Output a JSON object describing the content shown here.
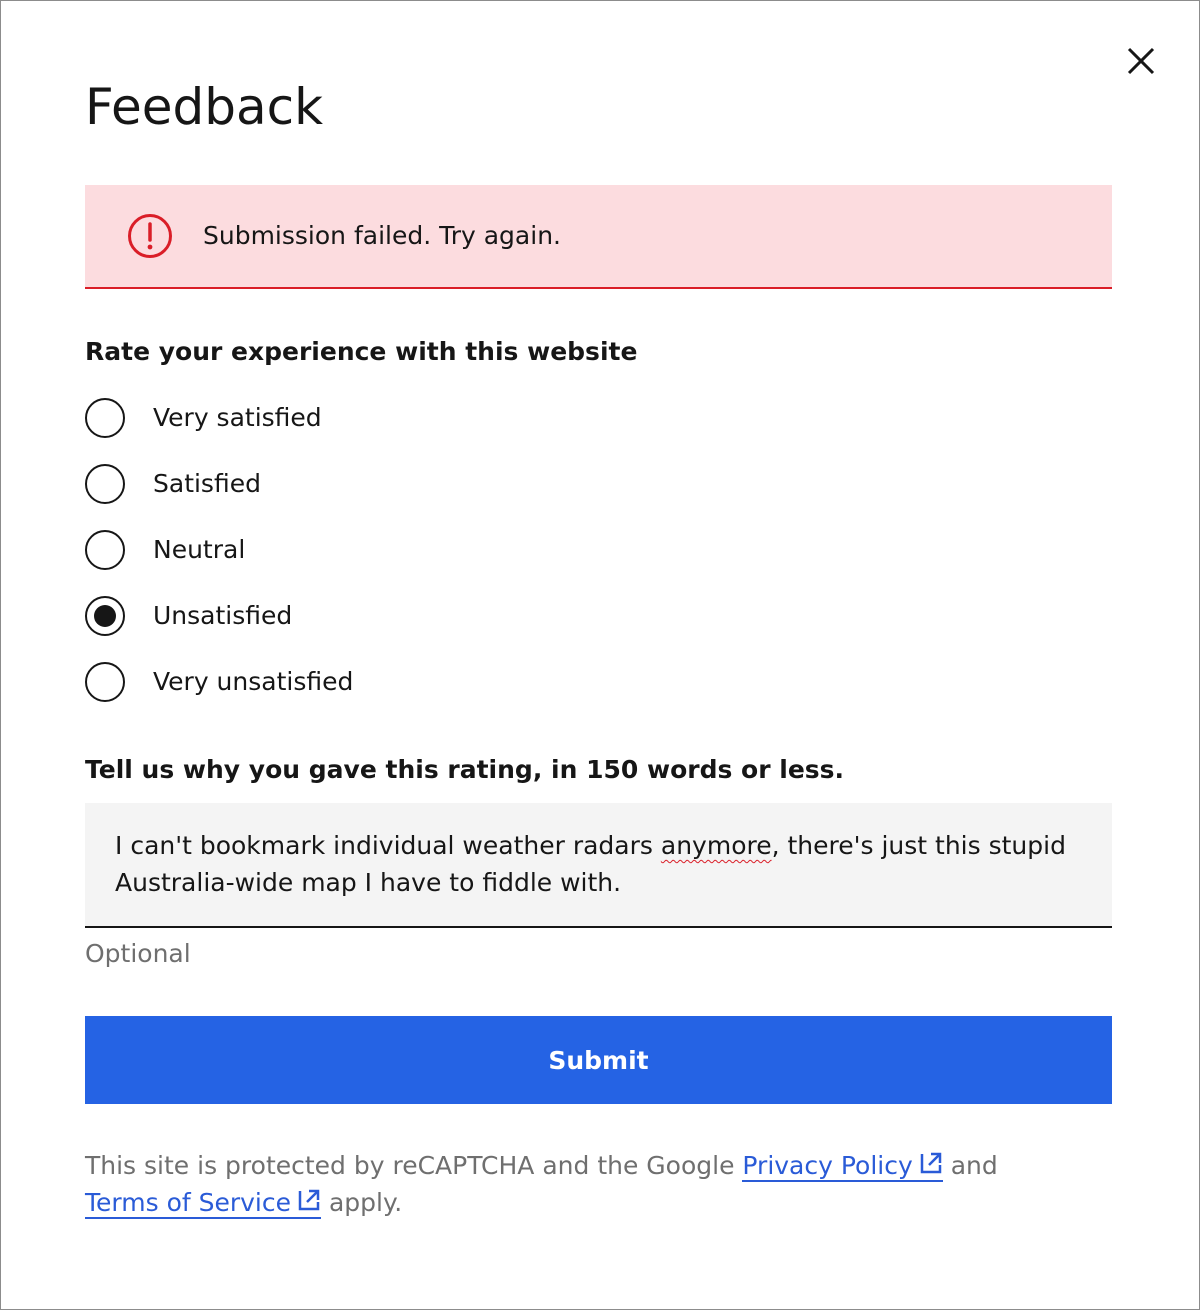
{
  "dialog": {
    "title": "Feedback",
    "close_icon": "close-icon"
  },
  "alert": {
    "icon": "error-exclamation-icon",
    "message": "Submission failed. Try again.",
    "color": "#da1e28",
    "background": "#fcdcdf"
  },
  "rating": {
    "legend": "Rate your experience with this website",
    "options": [
      {
        "label": "Very satisfied",
        "selected": false
      },
      {
        "label": "Satisfied",
        "selected": false
      },
      {
        "label": "Neutral",
        "selected": false
      },
      {
        "label": "Unsatisfied",
        "selected": true
      },
      {
        "label": "Very unsatisfied",
        "selected": false
      }
    ]
  },
  "comment": {
    "label": "Tell us why you gave this rating, in 150 words or less.",
    "value_before": "I can't bookmark individual weather radars ",
    "value_misspelled": "anymore",
    "value_after": ", there's just this stupid Australia-wide map I have to fiddle with.",
    "helper": "Optional"
  },
  "submit": {
    "label": "Submit",
    "color": "#2563e4"
  },
  "recaptcha": {
    "prefix": "This site is protected by reCAPTCHA and the Google ",
    "privacy_link": "Privacy Policy",
    "middle": " and ",
    "terms_link": "Terms of Service",
    "suffix": " apply.",
    "link_icon": "external-link-icon"
  }
}
